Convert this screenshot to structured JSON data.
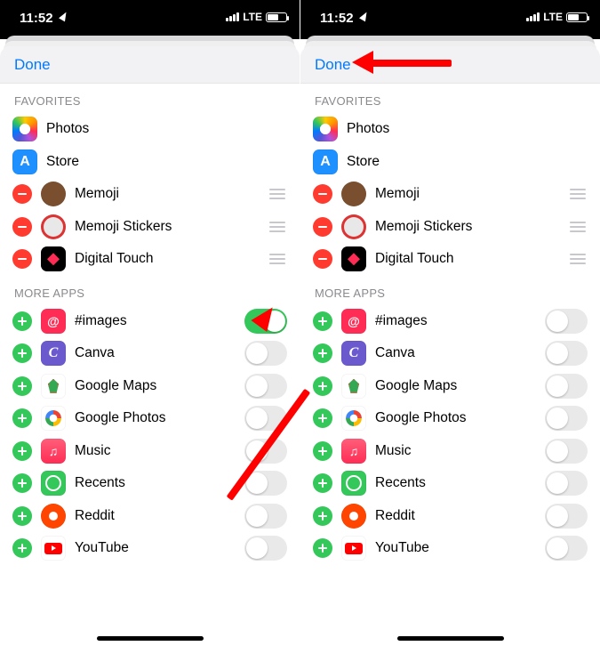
{
  "status": {
    "time": "11:52",
    "network": "LTE"
  },
  "nav": {
    "done": "Done"
  },
  "sections": {
    "favorites_header": "FAVORITES",
    "more_header": "MORE APPS"
  },
  "favorites": [
    {
      "name": "Photos",
      "icon": "photos-icon",
      "removable": false,
      "reorder": false
    },
    {
      "name": "Store",
      "icon": "store-icon",
      "removable": false,
      "reorder": false
    },
    {
      "name": "Memoji",
      "icon": "memoji-icon",
      "removable": true,
      "reorder": true
    },
    {
      "name": "Memoji Stickers",
      "icon": "memoji-stickers-icon",
      "removable": true,
      "reorder": true
    },
    {
      "name": "Digital Touch",
      "icon": "digital-touch-icon",
      "removable": true,
      "reorder": true
    }
  ],
  "more_apps": [
    {
      "name": "#images",
      "icon": "images-icon"
    },
    {
      "name": "Canva",
      "icon": "canva-icon"
    },
    {
      "name": "Google Maps",
      "icon": "gmaps-icon"
    },
    {
      "name": "Google Photos",
      "icon": "gphotos-icon"
    },
    {
      "name": "Music",
      "icon": "music-icon"
    },
    {
      "name": "Recents",
      "icon": "recents-icon"
    },
    {
      "name": "Reddit",
      "icon": "reddit-icon"
    },
    {
      "name": "YouTube",
      "icon": "youtube-icon"
    }
  ],
  "panes": {
    "left": {
      "images_toggle_on": true
    },
    "right": {
      "images_toggle_on": false
    }
  }
}
